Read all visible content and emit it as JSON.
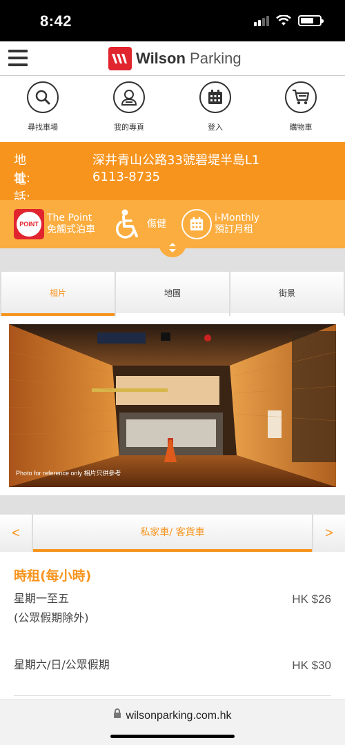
{
  "status_bar": {
    "time": "8:42"
  },
  "header": {
    "brand_bold": "Wilson",
    "brand_rest": "Parking"
  },
  "quick_nav": [
    {
      "label": "尋找車場",
      "icon": "search-icon"
    },
    {
      "label": "我的專頁",
      "icon": "profile-icon"
    },
    {
      "label": "登入",
      "icon": "calendar-icon"
    },
    {
      "label": "購物車",
      "icon": "cart-icon"
    }
  ],
  "carpark": {
    "address_label": "地址:",
    "address": "深井青山公路33號碧堤半島L1",
    "phone_label": "電話:",
    "phone": "6113-8735"
  },
  "features": {
    "the_point_logo": "POINT",
    "the_point_title": "The Point",
    "the_point_sub": "免觸式泊車",
    "accessible": "傷健",
    "imonthly_title": "i-Monthly",
    "imonthly_sub": "預訂月租"
  },
  "tabs": [
    {
      "label": "相片",
      "active": true
    },
    {
      "label": "地圖",
      "active": false
    },
    {
      "label": "街景",
      "active": false
    }
  ],
  "photo": {
    "caption": "Photo for reference only  相片只供參考"
  },
  "vehicle": {
    "prev": "<",
    "next": ">",
    "current": "私家車/ 客貨車"
  },
  "rates": {
    "title": "時租(每小時)",
    "rows": [
      {
        "label_line1": "星期一至五",
        "label_line2": "(公眾假期除外)",
        "price": "HK $26"
      },
      {
        "label_line1": "星期六/日/公眾假期",
        "price": "HK $30"
      }
    ]
  },
  "browser": {
    "url": "wilsonparking.com.hk"
  },
  "colors": {
    "brand_red": "#e1252f",
    "accent_orange": "#f7941d",
    "light_orange": "#fbad3f"
  }
}
